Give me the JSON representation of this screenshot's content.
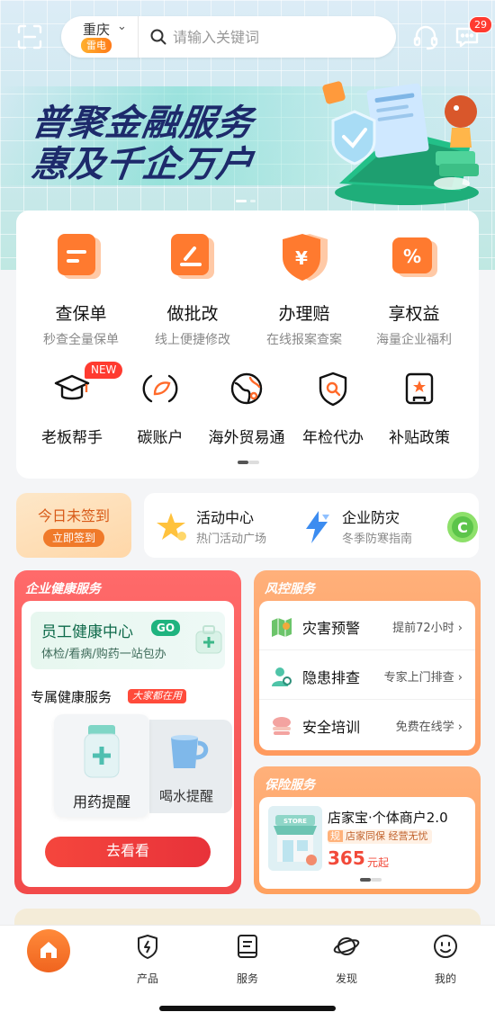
{
  "header": {
    "city": "重庆",
    "city_tag": "雷电",
    "search_placeholder": "请输入关键词",
    "message_badge": "29"
  },
  "banner": {
    "line1": "普聚金融服务",
    "line2": "惠及千企万户"
  },
  "main_services": [
    {
      "title": "查保单",
      "subtitle": "秒查全量保单",
      "icon": "policy-doc-icon"
    },
    {
      "title": "做批改",
      "subtitle": "线上便捷修改",
      "icon": "edit-doc-icon"
    },
    {
      "title": "办理赔",
      "subtitle": "在线报案查案",
      "icon": "yuan-shield-icon"
    },
    {
      "title": "享权益",
      "subtitle": "海量企业福利",
      "icon": "percent-coupon-icon"
    }
  ],
  "sub_services": [
    {
      "title": "老板帮手",
      "icon": "graduation-cap-icon"
    },
    {
      "title": "碳账户",
      "icon": "leaf-cycle-icon"
    },
    {
      "title": "海外贸易通",
      "icon": "globe-icon"
    },
    {
      "title": "年检代办",
      "icon": "search-shield-icon"
    },
    {
      "title": "补贴政策",
      "icon": "star-document-icon"
    }
  ],
  "new_badge": "NEW",
  "checkin": {
    "title": "今日未签到",
    "button": "立即签到"
  },
  "activities": [
    {
      "title": "活动中心",
      "subtitle": "热门活动广场",
      "icon": "star-cluster-icon"
    },
    {
      "title": "企业防灾",
      "subtitle": "冬季防寒指南",
      "icon": "lightning-icon"
    }
  ],
  "health": {
    "section_title": "企业健康服务",
    "card_title": "员工健康中心",
    "card_go": "GO",
    "card_subtitle": "体检/看病/购药一站包办",
    "exclusive_title": "专属健康服务",
    "exclusive_tag": "大家都在用",
    "item1": "用药提醒",
    "item2": "喝水提醒",
    "button": "去看看"
  },
  "risk": {
    "section_title": "风控服务",
    "rows": [
      {
        "title": "灾害预警",
        "hint": "提前72小时 ›",
        "icon": "map-warning-icon"
      },
      {
        "title": "隐患排查",
        "hint": "专家上门排查 ›",
        "icon": "inspect-person-icon"
      },
      {
        "title": "安全培训",
        "hint": "免费在线学 ›",
        "icon": "training-books-icon"
      }
    ]
  },
  "insurance": {
    "section_title": "保险服务",
    "product": "店家宝·个体商户2.0",
    "tag_badge": "规",
    "tag_text": "店家同保 经营无忧",
    "price": "365",
    "unit": "元起",
    "store_label": "STORE"
  },
  "tabbar": [
    {
      "label": "",
      "icon": "home-icon"
    },
    {
      "label": "产品",
      "icon": "product-shield-icon"
    },
    {
      "label": "服务",
      "icon": "service-doc-icon"
    },
    {
      "label": "发现",
      "icon": "planet-icon"
    },
    {
      "label": "我的",
      "icon": "smile-face-icon"
    }
  ],
  "colors": {
    "accent": "#f0641f",
    "danger": "#f24a4a",
    "navy": "#1d2a6b"
  }
}
